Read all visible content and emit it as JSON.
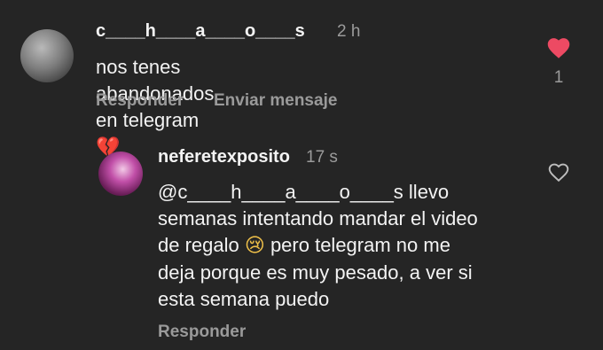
{
  "comments": [
    {
      "username": "c____h____a____o____s",
      "time": "2 h",
      "text": "nos tenes abandonados en telegram",
      "emoji": "💔",
      "actions": {
        "reply": "Responder",
        "message": "Enviar mensaje"
      },
      "like": {
        "icon": "heart-filled-icon",
        "color": "#ed4a63",
        "count": "1"
      }
    },
    {
      "username": "neferetexposito",
      "time": "17 s",
      "lines": [
        "@c____h____a____o____s llevo",
        "semanas intentando mandar el video",
        "de regalo",
        " pero telegram no me",
        "deja porque es muy pesado, a ver si",
        "esta semana puedo"
      ],
      "emoji": "😢",
      "actions": {
        "reply": "Responder"
      },
      "like": {
        "icon": "heart-outline-icon",
        "color": "#bdbdbd"
      }
    }
  ]
}
